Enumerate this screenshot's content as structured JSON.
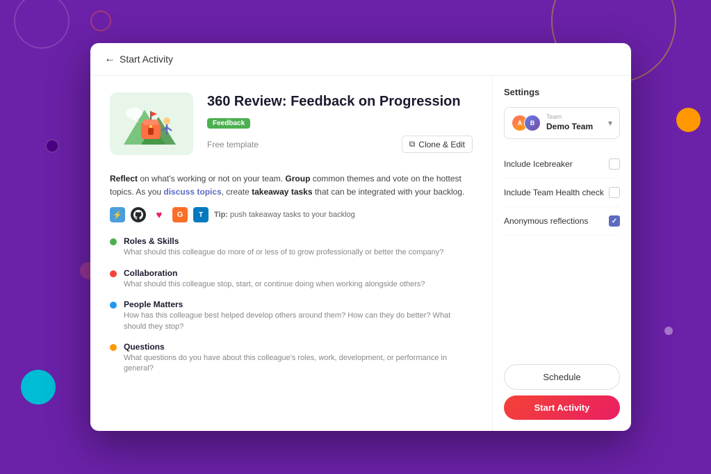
{
  "background": {
    "color": "#6b21a8"
  },
  "header": {
    "back_label": "Start Activity"
  },
  "activity": {
    "title": "360 Review: Feedback on Progression",
    "badge": "Feedback",
    "free_template_label": "Free template",
    "clone_edit_label": "Clone & Edit",
    "description_html": true,
    "description": "Reflect on what's working or not on your team. Group common themes and vote on the hottest topics. As you discuss topics, create takeaway tasks that can be integrated with your backlog.",
    "tip_label": "Tip:",
    "tip_text": "push takeaway tasks to your backlog",
    "topics": [
      {
        "name": "Roles & Skills",
        "desc": "What should this colleague do more of or less of to grow professionally or better the company?",
        "color": "green"
      },
      {
        "name": "Collaboration",
        "desc": "What should this colleague stop, start, or continue doing when working alongside others?",
        "color": "red"
      },
      {
        "name": "People Matters",
        "desc": "How has this colleague best helped develop others around them? How can they do better? What should they stop?",
        "color": "blue"
      },
      {
        "name": "Questions",
        "desc": "What questions do you have about this colleague's roles, work, development, or performance in general?",
        "color": "orange"
      }
    ]
  },
  "settings": {
    "title": "Settings",
    "team": {
      "label": "Team",
      "name": "Demo Team"
    },
    "options": [
      {
        "label": "Include Icebreaker",
        "checked": false,
        "id": "icebreaker"
      },
      {
        "label": "Include Team Health check",
        "checked": false,
        "id": "health-check"
      },
      {
        "label": "Anonymous reflections",
        "checked": true,
        "id": "anonymous"
      }
    ],
    "schedule_btn_label": "Schedule",
    "start_btn_label": "Start Activity"
  }
}
